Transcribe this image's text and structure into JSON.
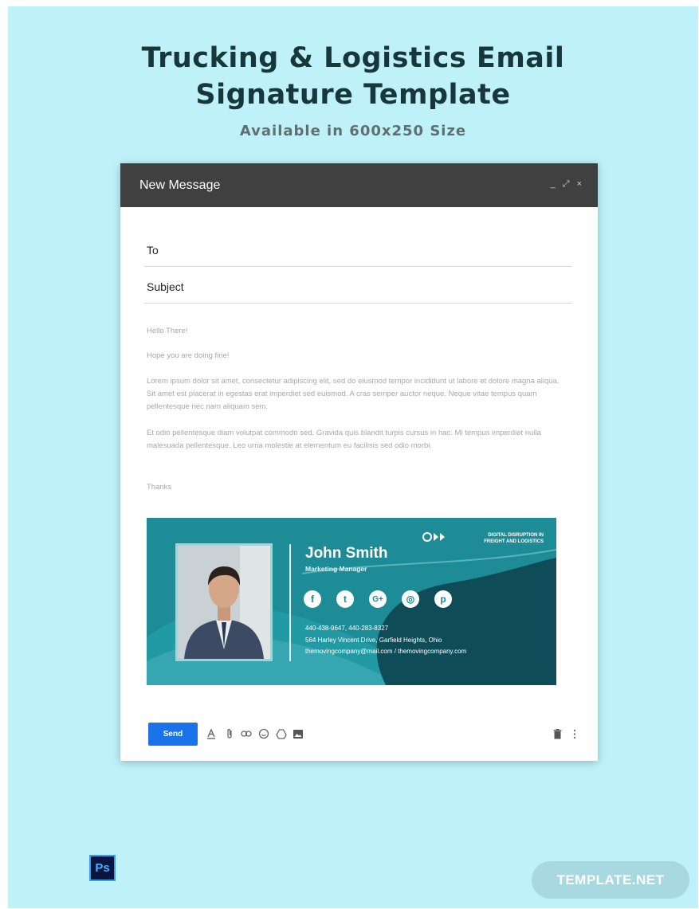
{
  "hero": {
    "title_line1": "Trucking & Logistics Email",
    "title_line2": "Signature Template",
    "subtitle": "Available in 600x250 Size"
  },
  "compose": {
    "title": "New Message",
    "window_controls": [
      "_",
      "⤢",
      "×"
    ],
    "to_label": "To",
    "subject_label": "Subject",
    "greeting": "Hello There!",
    "line2": "Hope you are doing fine!",
    "paragraph1": "Lorem ipsum dolor sit amet, consectetur adipiscing elit, sed do eiusmod tempor incididunt ut labore et dolore magna aliqua. Sit amet est placerat in egestas erat imperdiet sed euismod. A cras semper auctor neque. Neque vitae tempus quam pellentesque nec nam aliquam sem.",
    "paragraph2": " Et odio pellentesque diam volutpat commodo sed. Gravida quis blandit turpis cursus in hac. Mi tempus imperdiet nulla malesuada pellentesque. Leo urna molestie at elementum eu facilisis sed odio morbi.",
    "closing": "Thanks",
    "send_label": "Send"
  },
  "signature": {
    "name": "John Smith",
    "role": "Marketing Manager",
    "tagline_line1": "DIGITAL DISRUPTION IN",
    "tagline_line2": "FREIGHT AND LOGISTICS",
    "phone": "440-438-9647, 440-283-8327",
    "address": "564 Harley Vincent Drive, Garfield Heights, Ohio",
    "emails": "themovingcompany@mail.com / themovingcompany.com",
    "social_icons": [
      "facebook-icon",
      "twitter-icon",
      "google-plus-icon",
      "instagram-icon",
      "pinterest-icon"
    ],
    "social_glyphs": [
      "f",
      "t",
      "G+",
      "◎",
      "p"
    ]
  },
  "toolbar_icons": [
    "format-text-icon",
    "attach-icon",
    "link-icon",
    "emoji-icon",
    "drive-icon",
    "photo-icon"
  ],
  "footer": {
    "ps_badge": "Ps",
    "brand": "TEMPLATE.NET"
  },
  "colors": {
    "background": "#bff1f9",
    "title": "#17373a",
    "header": "#404040",
    "signature_teal": "#1d8c97",
    "signature_dark": "#0e4d57",
    "send_blue": "#1a73e8"
  }
}
